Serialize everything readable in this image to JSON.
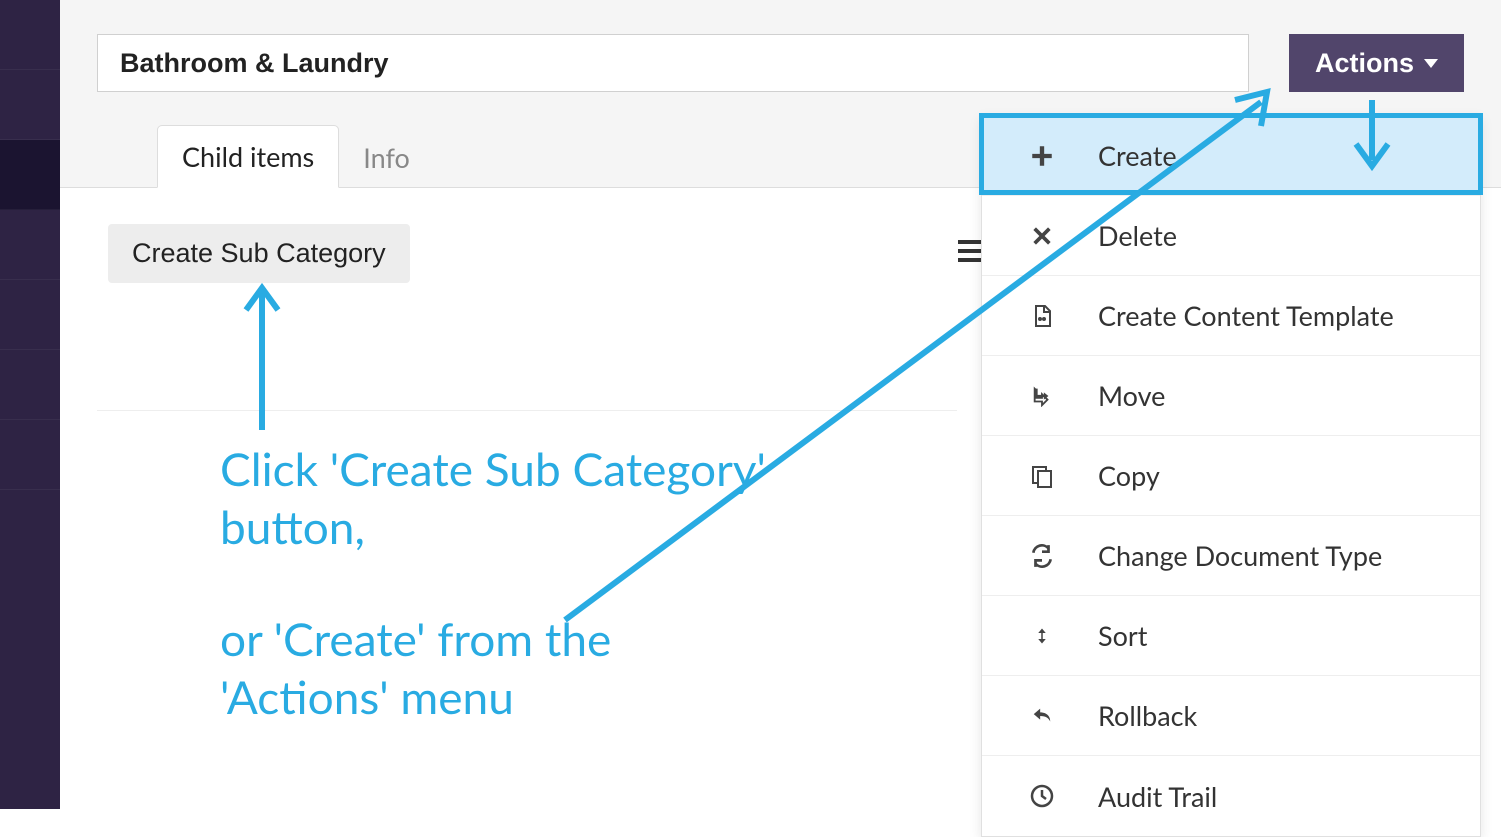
{
  "header": {
    "title_value": "Bathroom & Laundry",
    "actions_label": "Actions"
  },
  "tabs": {
    "child_items": "Child items",
    "info": "Info"
  },
  "content": {
    "create_sub_label": "Create Sub Category"
  },
  "actions_menu": [
    {
      "icon": "plus-icon",
      "label": "Create"
    },
    {
      "icon": "x-icon",
      "label": "Delete"
    },
    {
      "icon": "template-icon",
      "label": "Create Content Template"
    },
    {
      "icon": "move-icon",
      "label": "Move"
    },
    {
      "icon": "copy-icon",
      "label": "Copy"
    },
    {
      "icon": "change-icon",
      "label": "Change Document Type"
    },
    {
      "icon": "sort-icon",
      "label": "Sort"
    },
    {
      "icon": "rollback-icon",
      "label": "Rollback"
    },
    {
      "icon": "clock-icon",
      "label": "Audit Trail"
    }
  ],
  "annotation": {
    "line1": "Click 'Create Sub Category' button,",
    "line2": "or 'Create' from the 'Actions' menu"
  }
}
